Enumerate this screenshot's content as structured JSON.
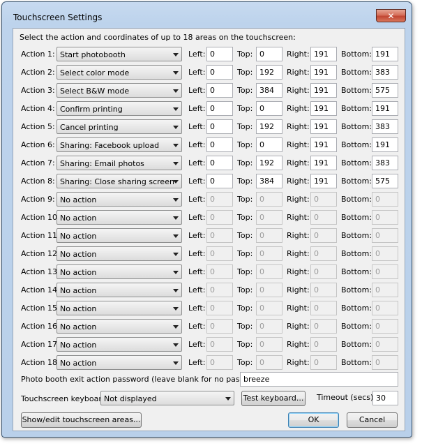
{
  "window": {
    "title": "Touchscreen Settings",
    "close_label": "✕"
  },
  "intro": "Select the action and coordinates of up to 18 areas on the touchscreen:",
  "labels": {
    "left": "Left:",
    "top": "Top:",
    "right": "Right:",
    "bottom": "Bottom:"
  },
  "actions": [
    {
      "label": "Action 1:",
      "action": "Start photobooth",
      "left": "0",
      "top": "0",
      "right": "191",
      "bottom": "191",
      "enabled": true
    },
    {
      "label": "Action 2:",
      "action": "Select color mode",
      "left": "0",
      "top": "192",
      "right": "191",
      "bottom": "383",
      "enabled": true
    },
    {
      "label": "Action 3:",
      "action": "Select B&W mode",
      "left": "0",
      "top": "384",
      "right": "191",
      "bottom": "575",
      "enabled": true
    },
    {
      "label": "Action 4:",
      "action": "Confirm printing",
      "left": "0",
      "top": "0",
      "right": "191",
      "bottom": "191",
      "enabled": true
    },
    {
      "label": "Action 5:",
      "action": "Cancel printing",
      "left": "0",
      "top": "192",
      "right": "191",
      "bottom": "383",
      "enabled": true
    },
    {
      "label": "Action 6:",
      "action": "Sharing: Facebook upload",
      "left": "0",
      "top": "0",
      "right": "191",
      "bottom": "191",
      "enabled": true
    },
    {
      "label": "Action 7:",
      "action": "Sharing: Email photos",
      "left": "0",
      "top": "192",
      "right": "191",
      "bottom": "383",
      "enabled": true
    },
    {
      "label": "Action 8:",
      "action": "Sharing: Close sharing screen",
      "left": "0",
      "top": "384",
      "right": "191",
      "bottom": "575",
      "enabled": true
    },
    {
      "label": "Action 9:",
      "action": "No action",
      "left": "0",
      "top": "0",
      "right": "0",
      "bottom": "0",
      "enabled": false
    },
    {
      "label": "Action 10:",
      "action": "No action",
      "left": "0",
      "top": "0",
      "right": "0",
      "bottom": "0",
      "enabled": false
    },
    {
      "label": "Action 11:",
      "action": "No action",
      "left": "0",
      "top": "0",
      "right": "0",
      "bottom": "0",
      "enabled": false
    },
    {
      "label": "Action 12:",
      "action": "No action",
      "left": "0",
      "top": "0",
      "right": "0",
      "bottom": "0",
      "enabled": false
    },
    {
      "label": "Action 13:",
      "action": "No action",
      "left": "0",
      "top": "0",
      "right": "0",
      "bottom": "0",
      "enabled": false
    },
    {
      "label": "Action 14:",
      "action": "No action",
      "left": "0",
      "top": "0",
      "right": "0",
      "bottom": "0",
      "enabled": false
    },
    {
      "label": "Action 15:",
      "action": "No action",
      "left": "0",
      "top": "0",
      "right": "0",
      "bottom": "0",
      "enabled": false
    },
    {
      "label": "Action 16:",
      "action": "No action",
      "left": "0",
      "top": "0",
      "right": "0",
      "bottom": "0",
      "enabled": false
    },
    {
      "label": "Action 17:",
      "action": "No action",
      "left": "0",
      "top": "0",
      "right": "0",
      "bottom": "0",
      "enabled": false
    },
    {
      "label": "Action 18:",
      "action": "No action",
      "left": "0",
      "top": "0",
      "right": "0",
      "bottom": "0",
      "enabled": false
    }
  ],
  "password": {
    "label": "Photo booth exit action password (leave blank for no password):",
    "value": "breeze"
  },
  "keyboard": {
    "label": "Touchscreen keyboard:",
    "value": "Not displayed",
    "test_button": "Test keyboard..."
  },
  "timeout": {
    "label": "Timeout (secs):",
    "value": "30"
  },
  "buttons": {
    "show_edit": "Show/edit touchscreen areas...",
    "ok": "OK",
    "cancel": "Cancel"
  }
}
